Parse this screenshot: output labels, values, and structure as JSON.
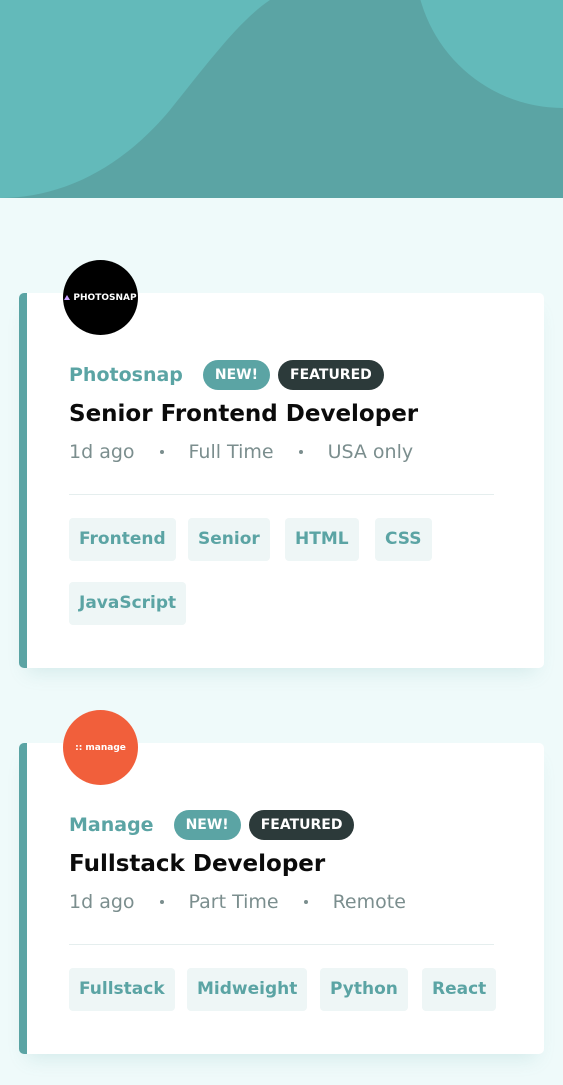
{
  "colors": {
    "primary": "#5ba4a4",
    "background": "#effafa",
    "tag_background": "#eef6f6",
    "featured": "#2c3a3a",
    "text_gray": "#7b8e8e"
  },
  "jobs": [
    {
      "logo_text": "PHOTOSNAP",
      "logo_color": "#000000",
      "logo_icon": "photosnap-logo-icon",
      "company": "Photosnap",
      "new_label": "NEW!",
      "featured_label": "FEATURED",
      "position": "Senior Frontend Developer",
      "posted": "1d ago",
      "contract": "Full Time",
      "location": "USA only",
      "tags": [
        "Frontend",
        "Senior",
        "HTML",
        "CSS",
        "JavaScript"
      ]
    },
    {
      "logo_text": ":: manage",
      "logo_color": "#f15f3b",
      "logo_icon": "manage-logo-icon",
      "company": "Manage",
      "new_label": "NEW!",
      "featured_label": "FEATURED",
      "position": "Fullstack Developer",
      "posted": "1d ago",
      "contract": "Part Time",
      "location": "Remote",
      "tags": [
        "Fullstack",
        "Midweight",
        "Python",
        "React"
      ]
    }
  ]
}
